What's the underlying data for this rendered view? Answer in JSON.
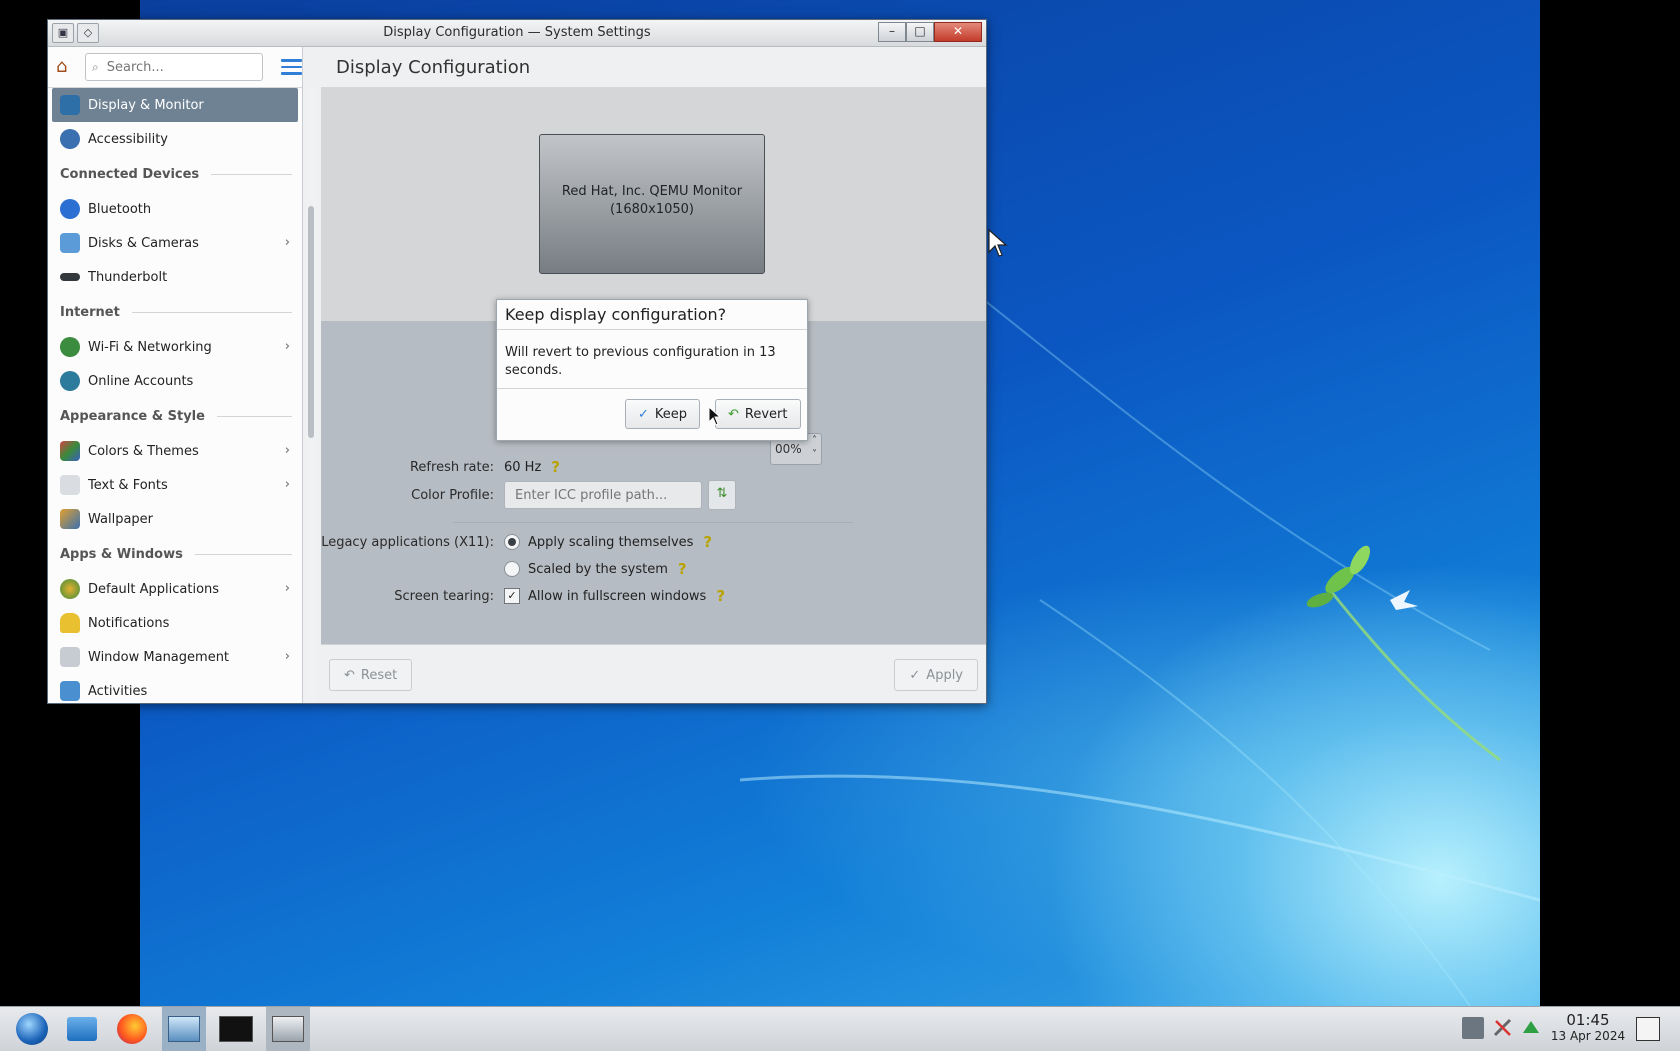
{
  "window": {
    "title": "Display Configuration — System Settings",
    "buttons": {
      "minimize": "–",
      "maximize": "□",
      "close": "✕"
    }
  },
  "sidebar": {
    "search_placeholder": "Search...",
    "items": [
      {
        "label": "Display & Monitor",
        "active": true
      },
      {
        "label": "Accessibility"
      }
    ],
    "sections": {
      "connected": "Connected Devices",
      "internet": "Internet",
      "appearance": "Appearance & Style",
      "apps": "Apps & Windows"
    },
    "connected_items": [
      "Bluetooth",
      "Disks & Cameras",
      "Thunderbolt"
    ],
    "internet_items": [
      "Wi-Fi & Networking",
      "Online Accounts"
    ],
    "appearance_items": [
      "Colors & Themes",
      "Text & Fonts",
      "Wallpaper"
    ],
    "apps_items": [
      "Default Applications",
      "Notifications",
      "Window Management",
      "Activities"
    ]
  },
  "main": {
    "header": "Display Configuration",
    "monitor": {
      "name": "Red Hat, Inc. QEMU Monitor",
      "resolution": "(1680x1050)"
    },
    "scale_value": "00%",
    "refresh_label": "Refresh rate:",
    "refresh_value": "60 Hz",
    "color_profile_label": "Color Profile:",
    "color_profile_placeholder": "Enter ICC profile path...",
    "legacy_label": "Legacy applications (X11):",
    "legacy_opt1": "Apply scaling themselves",
    "legacy_opt2": "Scaled by the system",
    "tearing_label": "Screen tearing:",
    "tearing_opt": "Allow in fullscreen windows",
    "reset_label": "Reset",
    "apply_label": "Apply"
  },
  "dialog": {
    "title": "Keep display configuration?",
    "message": "Will revert to previous configuration in 13 seconds.",
    "keep_label": "Keep",
    "revert_label": "Revert"
  },
  "taskbar": {
    "time": "01:45",
    "date": "13 Apr 2024"
  },
  "colors": {
    "sidebar_active": "#6e8293",
    "accent": "#2f7ed8",
    "desktop_blue": "#0b57c2"
  }
}
